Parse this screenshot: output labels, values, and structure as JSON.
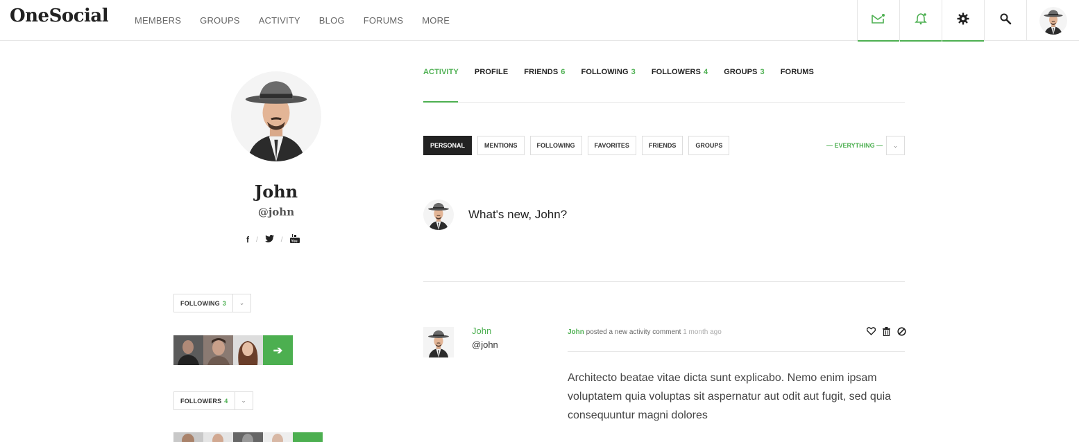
{
  "brand": {
    "logo": "OneSocial",
    "accent": "#4caf50"
  },
  "nav": {
    "items": [
      "MEMBERS",
      "GROUPS",
      "ACTIVITY",
      "BLOG",
      "FORUMS",
      "MORE"
    ],
    "icons": [
      "inbox-icon",
      "bell-icon",
      "gear-icon",
      "search-icon",
      "user-avatar"
    ]
  },
  "profile": {
    "name": "John",
    "handle": "@john",
    "socials": [
      "f",
      "twitter-icon",
      "youtube-icon"
    ],
    "following": {
      "label": "FOLLOWING",
      "count": "3"
    },
    "followers": {
      "label": "FOLLOWERS",
      "count": "4"
    },
    "next_arrow": "➔"
  },
  "tabs": [
    {
      "label": "ACTIVITY",
      "count": ""
    },
    {
      "label": "PROFILE",
      "count": ""
    },
    {
      "label": "FRIENDS",
      "count": "6"
    },
    {
      "label": "FOLLOWING",
      "count": "3"
    },
    {
      "label": "FOLLOWERS",
      "count": "4"
    },
    {
      "label": "GROUPS",
      "count": "3"
    },
    {
      "label": "FORUMS",
      "count": ""
    }
  ],
  "filters": [
    "PERSONAL",
    "MENTIONS",
    "FOLLOWING",
    "FAVORITES",
    "FRIENDS",
    "GROUPS"
  ],
  "filter_select": "— EVERYTHING —",
  "whats_new": "What's new, John?",
  "activity": {
    "name": "John",
    "handle": "@john",
    "meta_user": "John",
    "meta_action": " posted a new activity comment ",
    "meta_time": "1 month ago",
    "body": "Architecto beatae vitae dicta sunt explicabo. Nemo enim ipsam voluptatem quia voluptas sit aspernatur aut odit aut fugit, sed quia consequuntur magni dolores"
  }
}
